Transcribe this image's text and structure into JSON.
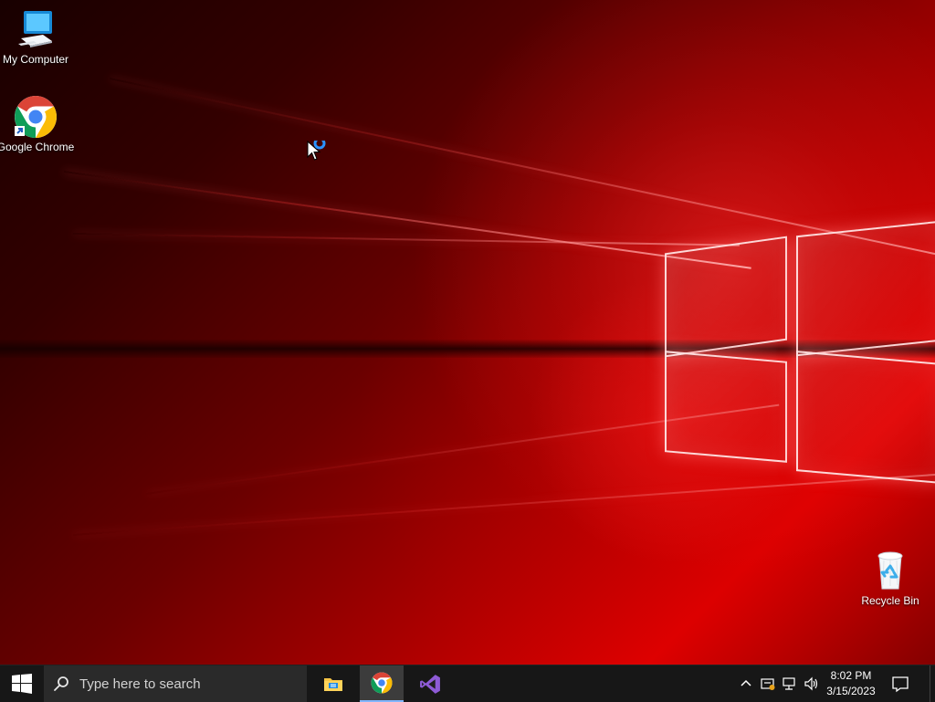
{
  "desktop": {
    "wallpaper_colors": {
      "dark": "#180000",
      "mid": "#8a0000",
      "bright": "#ff2a2a",
      "glow": "#ffd0d0"
    },
    "icons": [
      {
        "label": "My Computer",
        "icon": "computer-icon"
      },
      {
        "label": "Google Chrome",
        "icon": "chrome-icon",
        "shortcut": true
      },
      {
        "label": "Recycle Bin",
        "icon": "recycle-bin-icon"
      }
    ]
  },
  "taskbar": {
    "background_color": "#171717",
    "search": {
      "placeholder": "Type here to search",
      "value": ""
    },
    "apps": [
      {
        "name": "File Explorer",
        "icon": "file-explorer-icon"
      },
      {
        "name": "Google Chrome",
        "icon": "chrome-icon",
        "active": true
      },
      {
        "name": "Visual Studio",
        "icon": "visual-studio-icon"
      }
    ],
    "tray": {
      "icons": [
        "chevron-up-icon",
        "security-icon",
        "network-icon",
        "volume-icon"
      ],
      "time": "8:02 PM",
      "date": "3/15/2023",
      "notification_icon": "notification-icon"
    }
  }
}
